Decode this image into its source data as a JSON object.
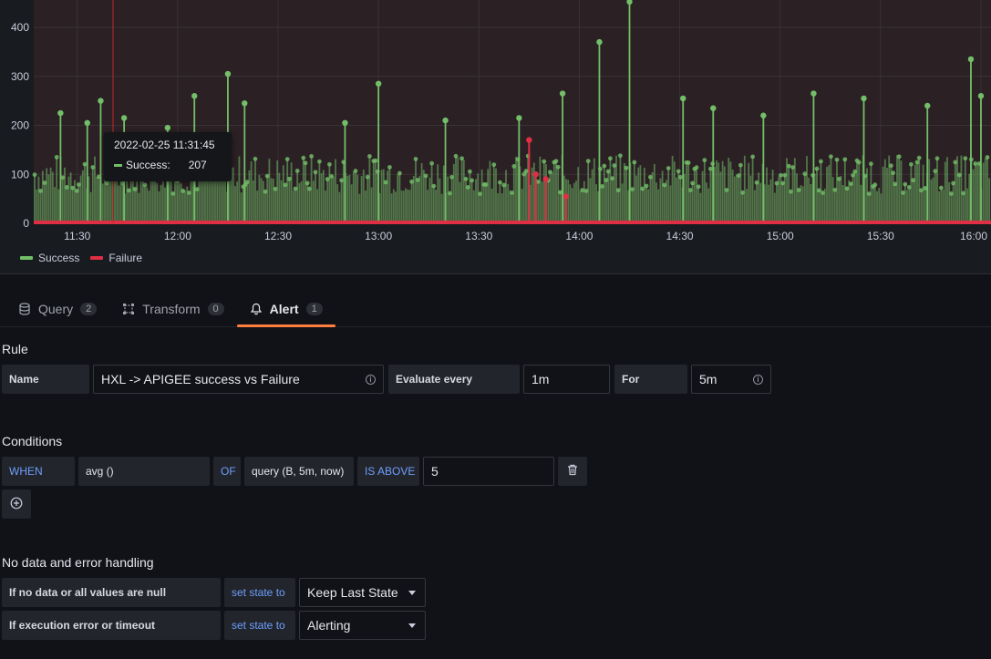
{
  "chart_data": {
    "type": "line",
    "x_ticks": [
      "11:30",
      "12:00",
      "12:30",
      "13:00",
      "13:30",
      "14:00",
      "14:30",
      "15:00",
      "15:30",
      "16:00"
    ],
    "y_ticks": [
      "0",
      "100",
      "200",
      "300",
      "400"
    ],
    "ylim": [
      0,
      450
    ],
    "grid": true,
    "legend_position": "bottom-left",
    "series": [
      {
        "name": "Success",
        "color": "#73bf69",
        "baseline_range": [
          60,
          140
        ],
        "spikes": [
          {
            "x": "11:25",
            "y": 225
          },
          {
            "x": "11:33",
            "y": 205
          },
          {
            "x": "11:37",
            "y": 250
          },
          {
            "x": "11:44",
            "y": 215
          },
          {
            "x": "11:57",
            "y": 195
          },
          {
            "x": "12:05",
            "y": 260
          },
          {
            "x": "12:15",
            "y": 305
          },
          {
            "x": "12:20",
            "y": 245
          },
          {
            "x": "12:50",
            "y": 205
          },
          {
            "x": "13:00",
            "y": 285
          },
          {
            "x": "13:20",
            "y": 210
          },
          {
            "x": "13:42",
            "y": 215
          },
          {
            "x": "13:55",
            "y": 265
          },
          {
            "x": "14:06",
            "y": 370
          },
          {
            "x": "14:15",
            "y": 455
          },
          {
            "x": "14:31",
            "y": 255
          },
          {
            "x": "14:40",
            "y": 235
          },
          {
            "x": "14:55",
            "y": 220
          },
          {
            "x": "15:10",
            "y": 265
          },
          {
            "x": "15:25",
            "y": 255
          },
          {
            "x": "15:44",
            "y": 240
          },
          {
            "x": "15:57",
            "y": 335
          },
          {
            "x": "16:00",
            "y": 260
          }
        ]
      },
      {
        "name": "Failure",
        "color": "#e02f44",
        "baseline_range": [
          0,
          5
        ],
        "spikes": [
          {
            "x": "13:45",
            "y": 170
          },
          {
            "x": "13:47",
            "y": 100
          },
          {
            "x": "13:50",
            "y": 90
          },
          {
            "x": "13:56",
            "y": 55
          }
        ]
      }
    ],
    "tooltip": {
      "time": "2022-02-25 11:31:45",
      "series": "Success:",
      "value": "207"
    }
  },
  "tabs": [
    {
      "label": "Query",
      "count": "2",
      "icon": "database-icon"
    },
    {
      "label": "Transform",
      "count": "0",
      "icon": "transform-icon"
    },
    {
      "label": "Alert",
      "count": "1",
      "icon": "bell-icon"
    }
  ],
  "rule": {
    "title": "Rule",
    "name_label": "Name",
    "name_value": "HXL ->  APIGEE success vs Failure",
    "evaluate_label": "Evaluate every",
    "evaluate_value": "1m",
    "for_label": "For",
    "for_value": "5m"
  },
  "conditions": {
    "title": "Conditions",
    "when": "WHEN",
    "func": "avg ()",
    "of": "OF",
    "query": "query (B, 5m, now)",
    "op": "IS ABOVE",
    "threshold": "5"
  },
  "nodata": {
    "title": "No data and error handling",
    "row1_label": "If no data or all values are null",
    "row1_kw": "set state to",
    "row1_value": "Keep Last State",
    "row2_label": "If execution error or timeout",
    "row2_kw": "set state to",
    "row2_value": "Alerting"
  }
}
